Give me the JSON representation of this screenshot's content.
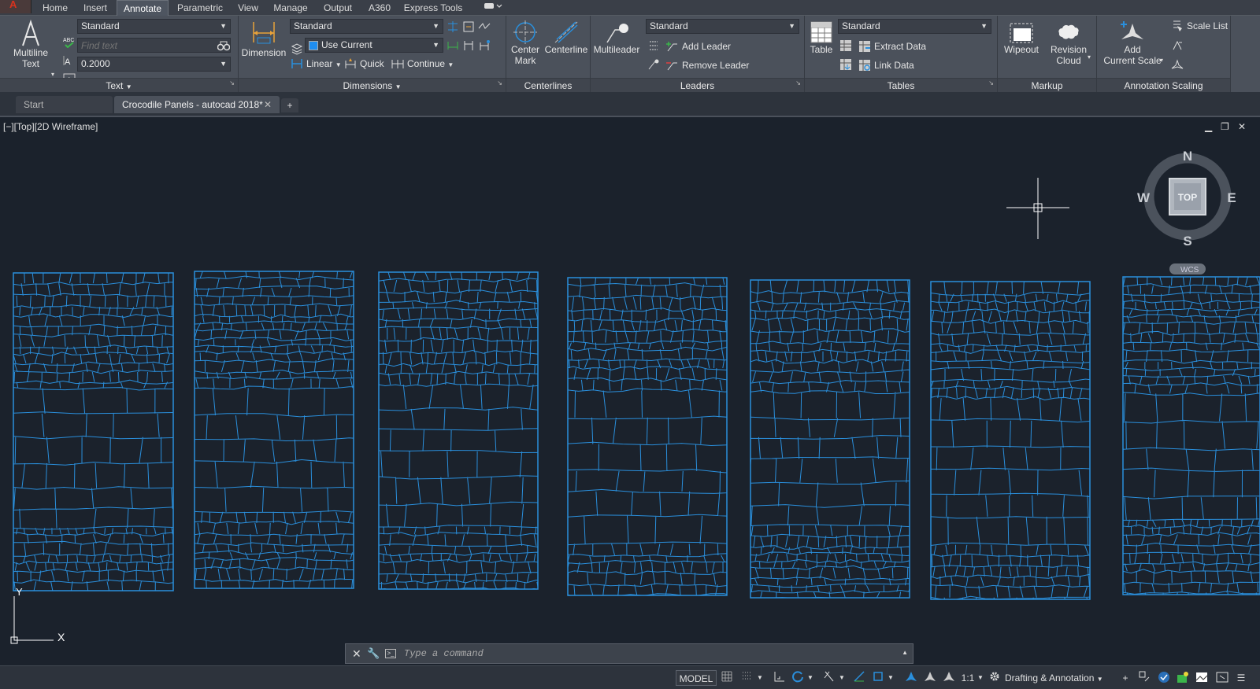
{
  "menu": {
    "tabs": [
      "Home",
      "Insert",
      "Annotate",
      "Parametric",
      "View",
      "Manage",
      "Output",
      "A360",
      "Express Tools"
    ],
    "active": "Annotate",
    "app_button": "A"
  },
  "ribbon": {
    "text_panel": {
      "title": "Text",
      "multiline_text": "Multiline\nText",
      "style_value": "Standard",
      "find_placeholder": "Find text",
      "height_value": "0.2000"
    },
    "dimensions_panel": {
      "title": "Dimensions",
      "dimension": "Dimension",
      "style_value": "Standard",
      "layer_value": "Use Current",
      "linear": "Linear",
      "quick": "Quick",
      "continue": "Continue"
    },
    "centerlines_panel": {
      "title": "Centerlines",
      "center_mark": "Center\nMark",
      "centerline": "Centerline"
    },
    "leaders_panel": {
      "title": "Leaders",
      "multileader": "Multileader",
      "style_value": "Standard",
      "add_leader": "Add Leader",
      "remove_leader": "Remove Leader"
    },
    "tables_panel": {
      "title": "Tables",
      "table": "Table",
      "style_value": "Standard",
      "extract_data": "Extract Data",
      "link_data": "Link Data"
    },
    "markup_panel": {
      "title": "Markup",
      "wipeout": "Wipeout",
      "revision_cloud": "Revision\nCloud"
    },
    "annotation_scaling_panel": {
      "title": "Annotation Scaling",
      "add_current_scale": "Add\nCurrent Scale",
      "scale_list": "Scale List"
    }
  },
  "doc_tabs": {
    "start": "Start",
    "active": "Crocodile Panels - autocad 2018*",
    "add": "+"
  },
  "viewport": {
    "label": "[−][Top][2D Wireframe]",
    "viewcube": {
      "n": "N",
      "s": "S",
      "e": "E",
      "w": "W",
      "face": "TOP",
      "wcs": "WCS"
    },
    "ucs": {
      "y": "Y",
      "x": "X"
    },
    "stroke_color": "#2a8fdc"
  },
  "command": {
    "placeholder": "Type a command"
  },
  "status": {
    "model": "MODEL",
    "scale": "1:1",
    "workspace": "Drafting & Annotation"
  },
  "colors": {
    "ribbon_bg": "#4b515b",
    "canvas_bg": "#1b222c",
    "panel_lines": "#2a8fdc"
  }
}
